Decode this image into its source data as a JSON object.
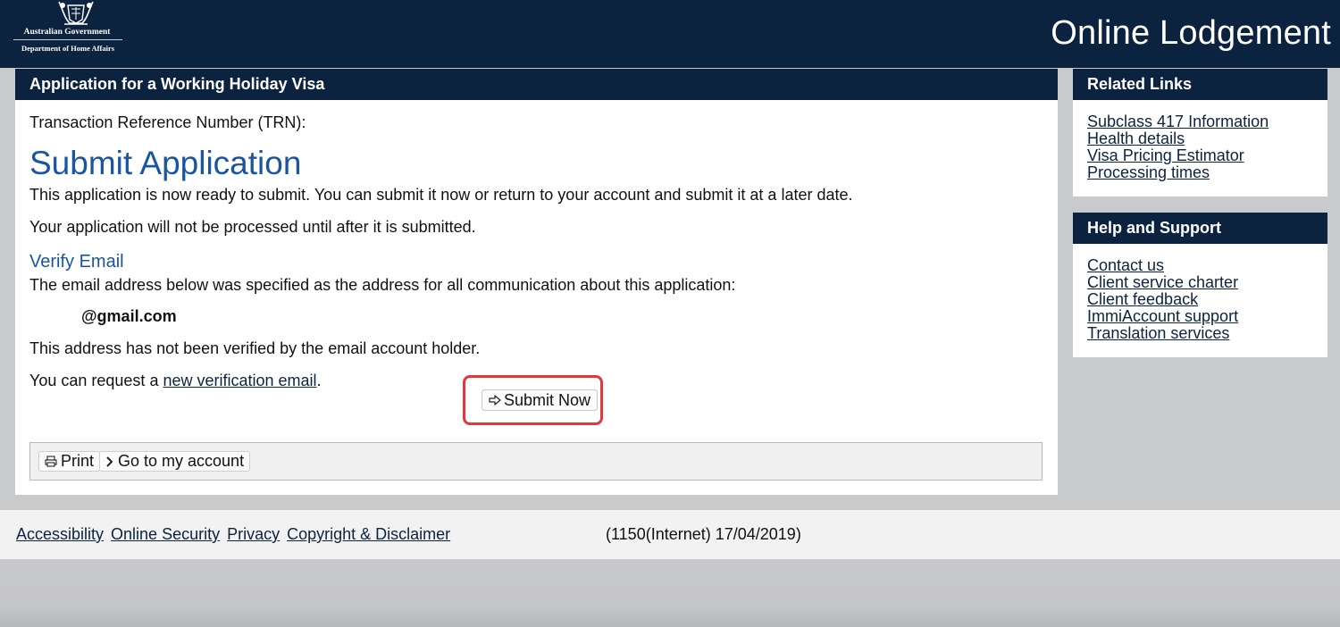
{
  "header": {
    "logo_line1": "Australian Government",
    "logo_line2": "Department of Home Affairs",
    "site_title": "Online Lodgement"
  },
  "main": {
    "panel_title": "Application for a Working Holiday Visa",
    "trn_label": "Transaction Reference Number (TRN):",
    "heading": "Submit Application",
    "para1": "This application is now ready to submit. You can submit it now or return to your account and submit it at a later date.",
    "para2": "Your application will not be processed until after it is submitted.",
    "verify_heading": "Verify Email",
    "verify_para": "The email address below was specified as the address for all communication about this application:",
    "email": "@gmail.com",
    "not_verified": "This address has not been verified by the email account holder.",
    "request_prefix": "You can request a ",
    "request_link": "new verification email",
    "request_suffix": ".",
    "submit_label": "Submit Now",
    "print_label": "Print",
    "account_label": "Go to my account"
  },
  "related_links": {
    "title": "Related Links",
    "items": [
      "Subclass 417 Information",
      "Health details",
      "Visa Pricing Estimator",
      "Processing times"
    ]
  },
  "help_support": {
    "title": "Help and Support",
    "items": [
      "Contact us",
      "Client service charter",
      "Client feedback",
      "ImmiAccount support",
      "Translation services"
    ]
  },
  "footer": {
    "links": [
      "Accessibility",
      "Online Security",
      "Privacy",
      "Copyright & Disclaimer"
    ],
    "version": "(1150(Internet) 17/04/2019)"
  },
  "colors": {
    "header_bg": "#0c2340",
    "heading_blue": "#1a56a0",
    "highlight_red": "#e0383e",
    "page_bg": "#c9cacc"
  },
  "icons": {
    "submit": "arrow-right-outline-icon",
    "print": "printer-icon",
    "account": "chevron-right-icon",
    "crest": "coat-of-arms-icon"
  }
}
